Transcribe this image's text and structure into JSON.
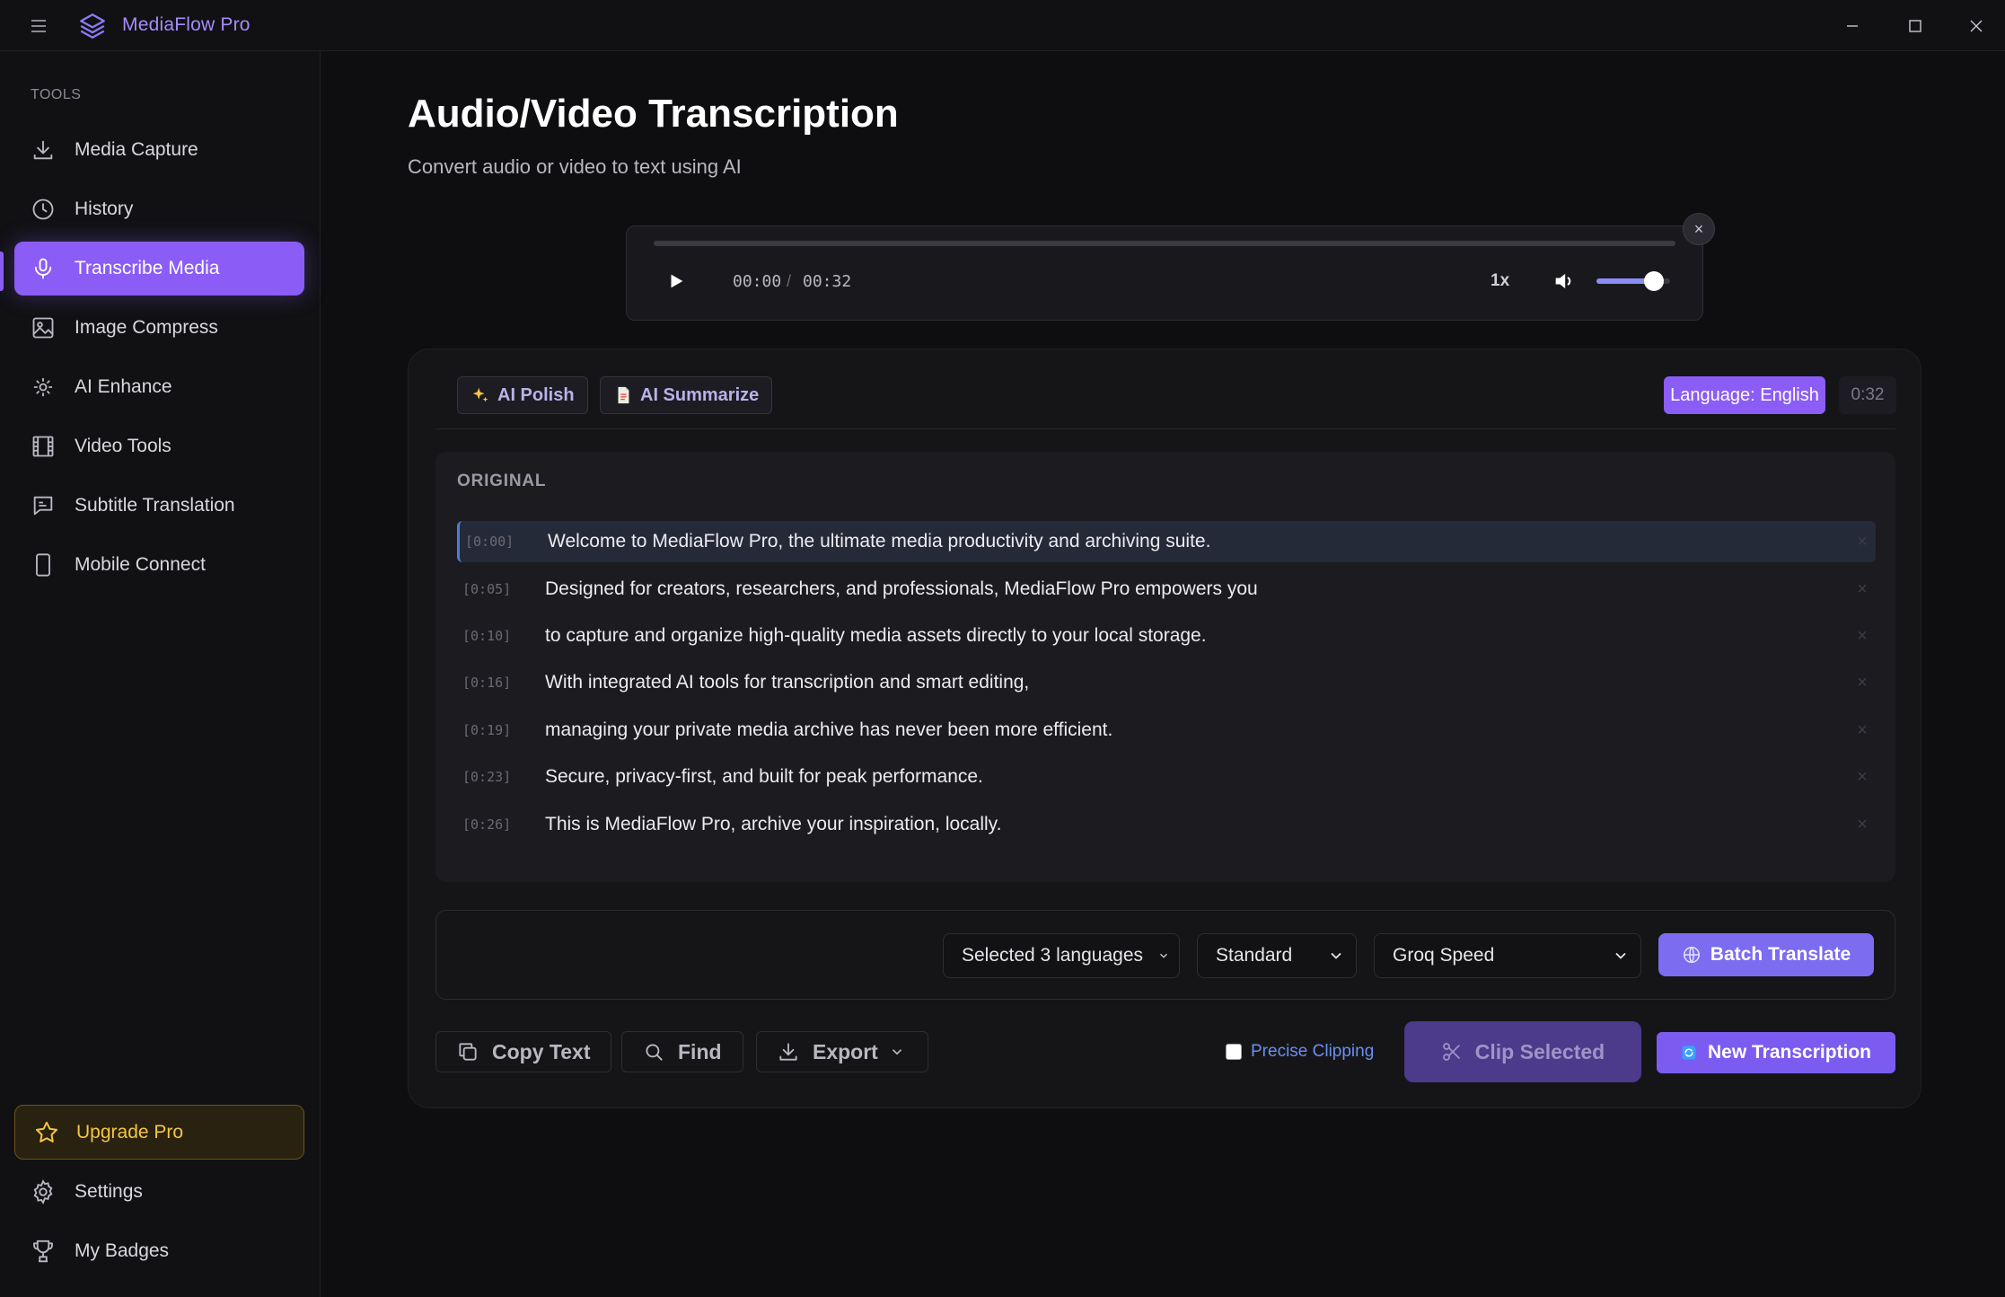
{
  "app": {
    "title": "MediaFlow Pro"
  },
  "sidebar": {
    "section_label": "TOOLS",
    "items": [
      {
        "label": "Media Capture",
        "icon": "download-icon"
      },
      {
        "label": "History",
        "icon": "clock-icon"
      },
      {
        "label": "Transcribe Media",
        "icon": "microphone-icon",
        "active": true
      },
      {
        "label": "Image Compress",
        "icon": "image-icon"
      },
      {
        "label": "AI Enhance",
        "icon": "sparkle-sun-icon"
      },
      {
        "label": "Video Tools",
        "icon": "film-icon"
      },
      {
        "label": "Subtitle Translation",
        "icon": "subtitle-icon"
      },
      {
        "label": "Mobile Connect",
        "icon": "phone-icon"
      }
    ],
    "upgrade_label": "Upgrade Pro",
    "settings_label": "Settings",
    "badges_label": "My Badges"
  },
  "main": {
    "title": "Audio/Video Transcription",
    "subtitle": "Convert audio or video to text using AI"
  },
  "player": {
    "current_time": "00:00",
    "separator": "/",
    "duration": "00:32",
    "speed": "1x",
    "close": "×",
    "progress": 0,
    "volume": 0.78
  },
  "panel": {
    "ai_polish_label": "AI Polish",
    "ai_summarize_label": "AI Summarize",
    "language_badge": "Language: English",
    "duration_badge": "0:32",
    "original_label": "ORIGINAL",
    "segments": [
      {
        "ts": "[0:00]",
        "text": "Welcome to MediaFlow Pro, the ultimate media productivity and archiving suite."
      },
      {
        "ts": "[0:05]",
        "text": "Designed for creators, researchers, and professionals, MediaFlow Pro empowers you"
      },
      {
        "ts": "[0:10]",
        "text": "to capture and organize high-quality media assets directly to your local storage."
      },
      {
        "ts": "[0:16]",
        "text": "With integrated AI tools for transcription and smart editing,"
      },
      {
        "ts": "[0:19]",
        "text": "managing your private media archive has never been more efficient."
      },
      {
        "ts": "[0:23]",
        "text": "Secure, privacy-first, and built for peak performance."
      },
      {
        "ts": "[0:26]",
        "text": "This is MediaFlow Pro, archive your inspiration, locally."
      }
    ],
    "delete_glyph": "×"
  },
  "translate": {
    "languages_select": "Selected 3 languages",
    "quality_select": "Standard",
    "engine_select": "Groq Speed",
    "batch_label": "Batch Translate"
  },
  "actions": {
    "copy_label": "Copy Text",
    "find_label": "Find",
    "export_label": "Export",
    "precise_label": "Precise Clipping",
    "clip_label": "Clip Selected",
    "new_label": "New Transcription"
  },
  "colors": {
    "accent": "#8b5cf6",
    "upgrade": "#f5c542",
    "background": "#0e0e10"
  }
}
